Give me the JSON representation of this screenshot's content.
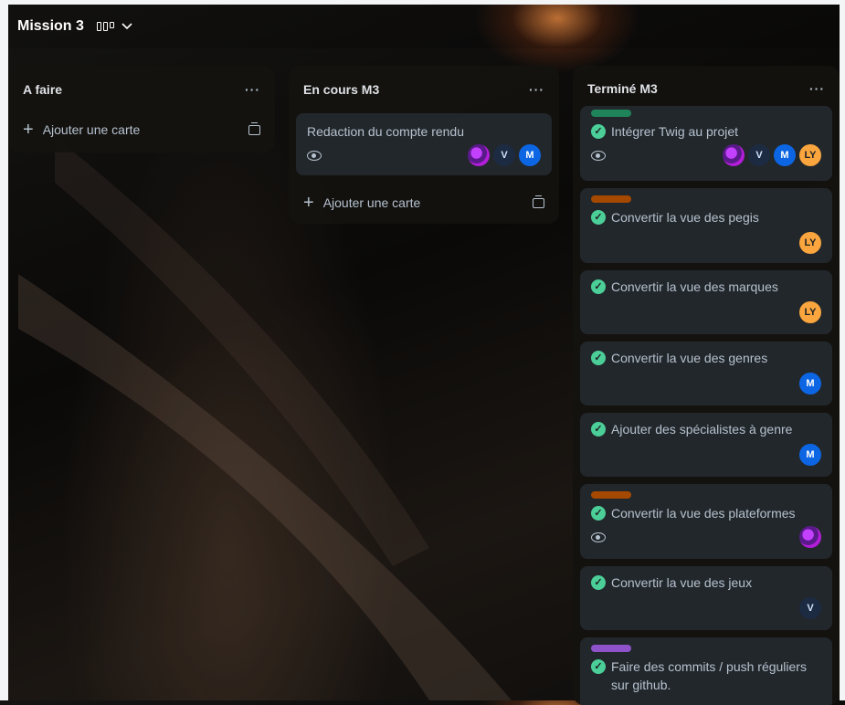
{
  "board": {
    "title": "Mission 3",
    "view_icon": "board-view-icon",
    "view_dropdown": "chevron-down-icon"
  },
  "colors": {
    "green_label": "#1f845a",
    "orange_label": "#a54800",
    "purple_label": "#8f53c9",
    "check": "#4bce97",
    "avatar_m": "#0c66e4",
    "avatar_ly": "#faa53d",
    "avatar_v": "#1c2b41"
  },
  "lists": [
    {
      "title": "A faire",
      "menu": "···",
      "add_label": "Ajouter une carte",
      "cards": []
    },
    {
      "title": "En cours M3",
      "menu": "···",
      "add_label": "Ajouter une carte",
      "cards": [
        {
          "title": "Redaction du compte rendu",
          "watching": true,
          "members": [
            "pixel",
            "V",
            "M"
          ]
        }
      ]
    },
    {
      "title": "Terminé M3",
      "menu": "···",
      "cards": [
        {
          "label": "green",
          "title": "Intégrer Twig au projet",
          "complete": true,
          "watching": true,
          "members": [
            "pixel",
            "V",
            "M",
            "LY"
          ]
        },
        {
          "label": "orange",
          "title": "Convertir la vue des pegis",
          "complete": true,
          "members": [
            "LY"
          ]
        },
        {
          "title": "Convertir la vue des marques",
          "complete": true,
          "members": [
            "LY"
          ]
        },
        {
          "title": "Convertir la vue des genres",
          "complete": true,
          "members": [
            "M"
          ]
        },
        {
          "title": "Ajouter des spécialistes à genre",
          "complete": true,
          "members": [
            "M"
          ]
        },
        {
          "label": "orange",
          "title": "Convertir la vue des plateformes",
          "complete": true,
          "watching": true,
          "members": [
            "pixel"
          ]
        },
        {
          "title": "Convertir la vue des jeux",
          "complete": true,
          "members": [
            "V"
          ]
        },
        {
          "label": "purple",
          "title": "Faire des commits / push réguliers sur github.",
          "complete": true,
          "members": []
        }
      ]
    }
  ]
}
